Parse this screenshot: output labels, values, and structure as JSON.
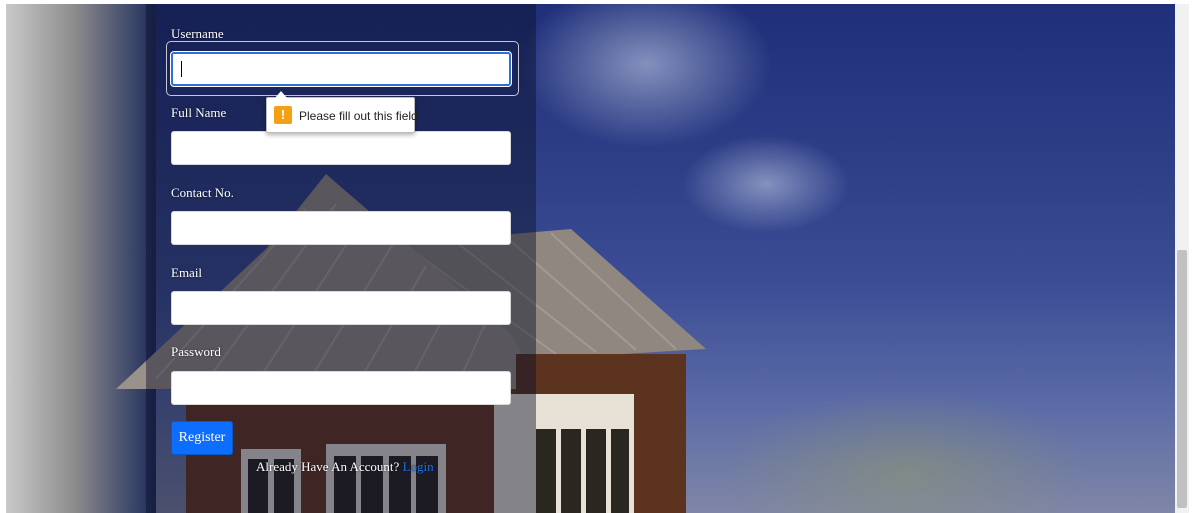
{
  "form": {
    "username": {
      "label": "Username",
      "value": "",
      "placeholder": ""
    },
    "full_name": {
      "label": "Full Name",
      "value": "",
      "placeholder": ""
    },
    "contact_no": {
      "label": "Contact No.",
      "value": "",
      "placeholder": ""
    },
    "email": {
      "label": "Email",
      "value": "",
      "placeholder": ""
    },
    "password": {
      "label": "Password",
      "value": "",
      "placeholder": ""
    },
    "register_label": "Register",
    "already_text": "Already Have An Account?",
    "login_link": "Login"
  },
  "validation_tooltip": {
    "icon": "warning-icon",
    "icon_glyph": "!",
    "message": "Please fill out this field."
  },
  "colors": {
    "accent": "#0d6efd",
    "warning": "#f4a012",
    "link": "#1a73e8"
  }
}
